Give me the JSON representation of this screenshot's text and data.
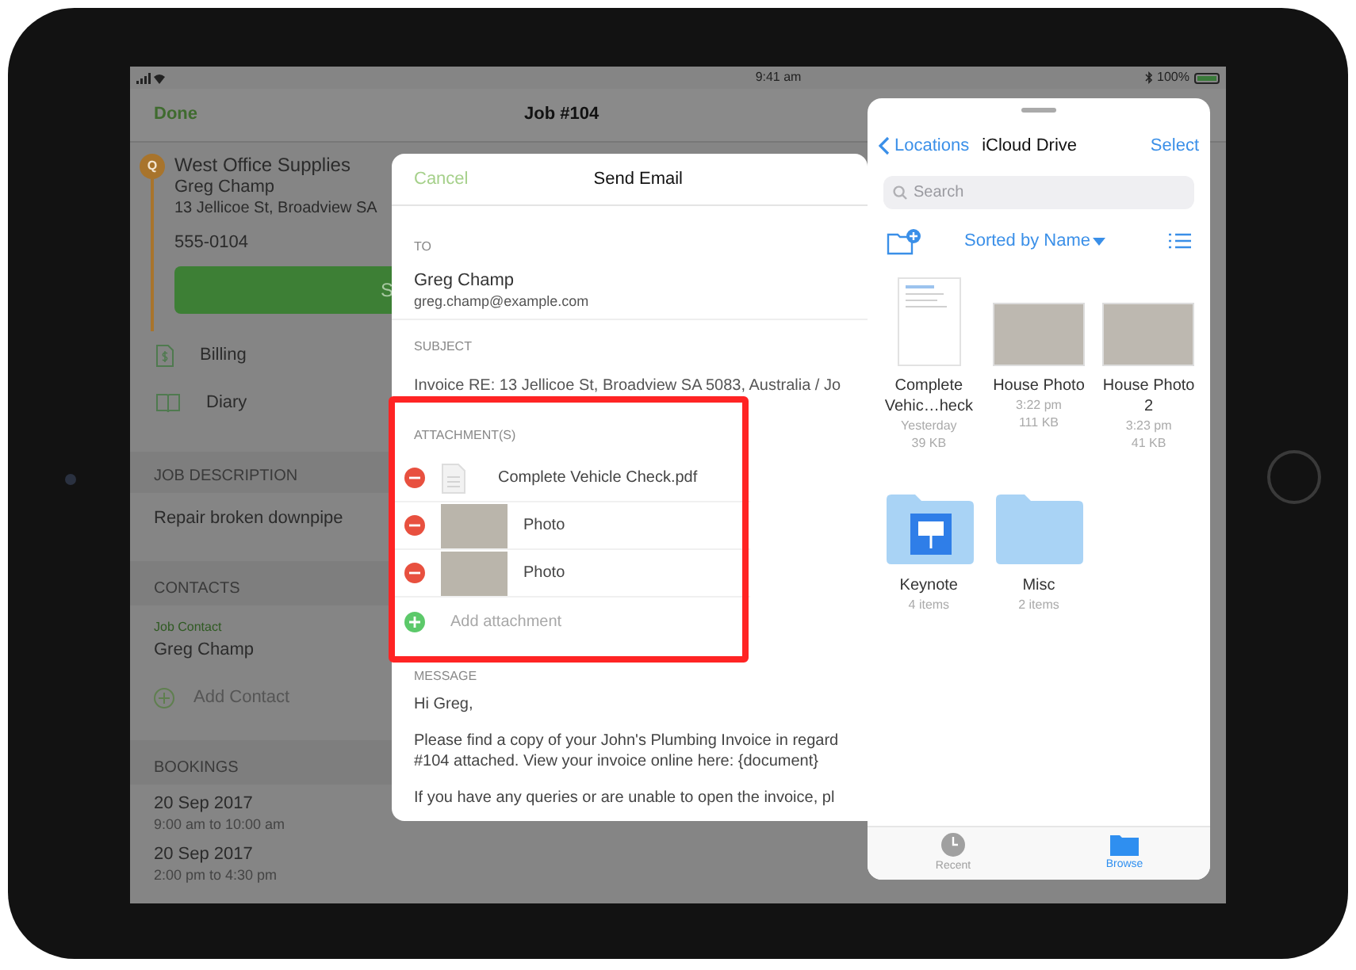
{
  "status_bar": {
    "time": "9:41 am",
    "battery": "100%"
  },
  "nav": {
    "left": "Done",
    "title": "Job #104"
  },
  "customer": {
    "badge": "Q",
    "name": "West Office Supplies",
    "contact": "Greg Champ",
    "address": "13 Jellicoe St, Broadview SA",
    "phone": "555-0104",
    "button": "S"
  },
  "menu": [
    {
      "label": "Billing",
      "kind": "billing"
    },
    {
      "label": "Diary",
      "kind": "diary"
    }
  ],
  "job_description": {
    "heading": "JOB DESCRIPTION",
    "text": "Repair broken downpipe"
  },
  "contacts": {
    "heading": "CONTACTS",
    "role": "Job Contact",
    "name": "Greg Champ",
    "add": "Add Contact"
  },
  "bookings": {
    "heading": "BOOKINGS",
    "items": [
      {
        "date": "20 Sep 2017",
        "time": "9:00 am to 10:00 am"
      },
      {
        "date": "20 Sep 2017",
        "time": "2:00 pm to 4:30 pm"
      }
    ]
  },
  "email": {
    "cancel": "Cancel",
    "title": "Send Email",
    "to_label": "TO",
    "to_name": "Greg Champ",
    "to_email": "greg.champ@example.com",
    "subject_label": "SUBJECT",
    "subject": "Invoice RE: 13 Jellicoe St, Broadview SA 5083, Australia / Jo",
    "attachments_label": "ATTACHMENT(S)",
    "attachments_highlighted": true,
    "attachments": [
      {
        "name": "Complete Vehicle Check.pdf",
        "kind": "document"
      },
      {
        "name": "Photo",
        "kind": "photo"
      },
      {
        "name": "Photo",
        "kind": "photo"
      }
    ],
    "add_attachment": "Add attachment",
    "message_label": "MESSAGE",
    "message": [
      {
        "lines": [
          "Hi Greg,"
        ]
      },
      {
        "lines": [
          "Please find a copy of your John's Plumbing Invoice in regard",
          "#104 attached. View your invoice online here: {document}"
        ]
      },
      {
        "lines": [
          "If you have any queries or are unable to open the invoice, pl"
        ]
      }
    ]
  },
  "picker": {
    "back": "Locations",
    "title": "iCloud Drive",
    "action": "Select",
    "search_placeholder": "Search",
    "sort": "Sorted by Name",
    "files": [
      {
        "kind": "document",
        "name": "Complete Vehic…heck",
        "meta": [
          "Yesterday",
          "39 KB"
        ]
      },
      {
        "kind": "photo",
        "name": "House Photo",
        "meta": [
          "3:22 pm",
          "111 KB"
        ]
      },
      {
        "kind": "photo",
        "name": "House Photo 2",
        "meta": [
          "3:23 pm",
          "41 KB"
        ]
      },
      {
        "kind": "app-folder",
        "name": "Keynote",
        "meta": [
          "4 items"
        ]
      },
      {
        "kind": "folder",
        "name": "Misc",
        "meta": [
          "2 items"
        ]
      }
    ],
    "tabs": [
      {
        "label": "Recent",
        "kind": "recent",
        "selected": false
      },
      {
        "label": "Browse",
        "kind": "browse",
        "selected": true
      }
    ]
  }
}
